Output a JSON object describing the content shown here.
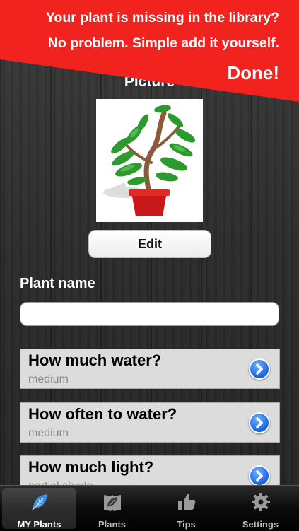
{
  "banner": {
    "line1": "Your plant is missing in the library?",
    "line2": "No problem. Simple add it yourself.",
    "done_label": "Done!"
  },
  "picture": {
    "label": "Picture",
    "edit_label": "Edit"
  },
  "plant_name": {
    "label": "Plant name",
    "value": "",
    "placeholder": ""
  },
  "options": [
    {
      "title": "How much water?",
      "value": "medium"
    },
    {
      "title": "How often to water?",
      "value": "medium"
    },
    {
      "title": "How much light?",
      "value": "partial shade"
    }
  ],
  "tabbar": {
    "tabs": [
      {
        "label": "MY Plants",
        "icon": "leaf-icon",
        "active": true
      },
      {
        "label": "Plants",
        "icon": "leaf-book-icon",
        "active": false
      },
      {
        "label": "Tips",
        "icon": "thumbs-up-icon",
        "active": false
      },
      {
        "label": "Settings",
        "icon": "gear-icon",
        "active": false
      }
    ]
  },
  "colors": {
    "banner": "#f2231f",
    "accent_blue": "#1a64e0"
  }
}
